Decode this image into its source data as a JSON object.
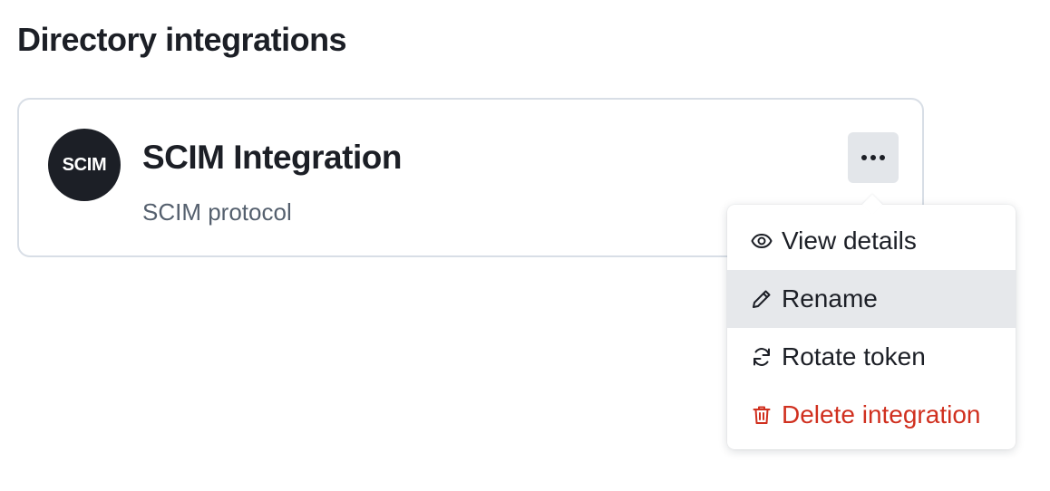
{
  "page": {
    "title": "Directory integrations"
  },
  "integration_card": {
    "logo_text": "SCIM",
    "title": "SCIM Integration",
    "subtitle": "SCIM protocol",
    "more_button_icon": "ellipsis-horizontal-icon"
  },
  "actions_menu": {
    "items": [
      {
        "label": "View details",
        "icon": "eye-icon",
        "state": "default"
      },
      {
        "label": "Rename",
        "icon": "pencil-icon",
        "state": "hovered"
      },
      {
        "label": "Rotate token",
        "icon": "refresh-icon",
        "state": "default"
      },
      {
        "label": "Delete integration",
        "icon": "trash-icon",
        "state": "danger"
      }
    ]
  },
  "colors": {
    "text_primary": "#1c1f26",
    "text_secondary": "#55606e",
    "card_border": "#d8dee6",
    "button_bg": "#e3e6ea",
    "hover_bg": "#e6e8eb",
    "danger": "#d0301f"
  }
}
